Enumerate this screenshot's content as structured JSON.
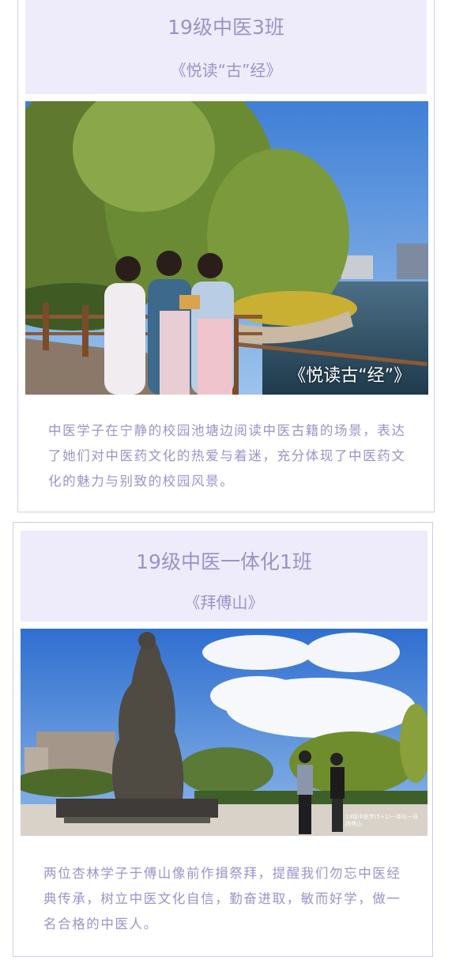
{
  "sections": [
    {
      "class_name": "19级中医3班",
      "work_title": "《悦读“古”经》",
      "photo_overlay": "《悦读古“经”》",
      "caption": "中医学子在宁静的校园池塘边阅读中医古籍的场景，表达了她们对中医药文化的热爱与着迷，充分体现了中医药文化的魅力与别致的校园风景。"
    },
    {
      "class_name": "19级中医一体化1班",
      "work_title": "《拜傅山》",
      "photo_overlay": "19级中医学(5+1)一体化一班 拜傅山",
      "caption": "两位杏林学子于傅山像前作揖祭拜，提醒我们勿忘中医经典传承，树立中医文化自信，勤奋进取，敏而好学，做一名合格的中医人。"
    }
  ],
  "colors": {
    "accent_text": "#9a93c9",
    "header_bg": "#eeecfb",
    "card_border": "#cfcbe8"
  }
}
